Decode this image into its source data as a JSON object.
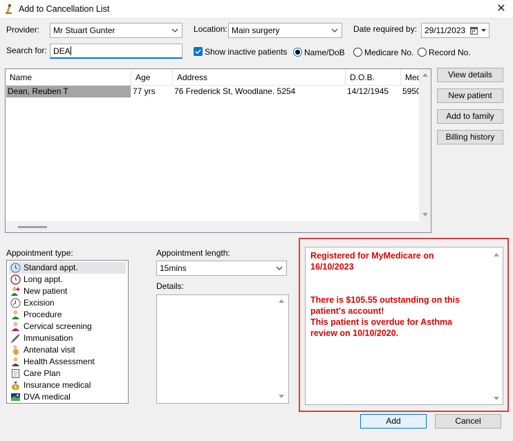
{
  "window": {
    "title": "Add to Cancellation List",
    "close_glyph": "✕"
  },
  "provider": {
    "label": "Provider:",
    "value": "Mr Stuart Gunter"
  },
  "location": {
    "label": "Location:",
    "value": "Main surgery"
  },
  "date_required": {
    "label": "Date required by:",
    "value": "29/11/2023"
  },
  "search": {
    "label": "Search for:",
    "value": "DEA"
  },
  "show_inactive": {
    "label": "Show inactive patients",
    "checked": true
  },
  "search_mode": {
    "options": [
      "Name/DoB",
      "Medicare No.",
      "Record No."
    ],
    "selected": "Name/DoB"
  },
  "patient_table": {
    "columns": [
      "Name",
      "Age",
      "Address",
      "D.O.B.",
      "Med"
    ],
    "rows": [
      {
        "name": "Dean, Reuben T",
        "age": "77 yrs",
        "address": "76 Frederick St, Woodlane. 5254",
        "dob": "14/12/1945",
        "medicare": "5950"
      }
    ]
  },
  "side_buttons": [
    "View details",
    "New patient",
    "Add to family",
    "Billing history"
  ],
  "appointment_type": {
    "label": "Appointment type:",
    "items": [
      {
        "label": "Standard appt.",
        "icon": "clock-icon",
        "selected": true
      },
      {
        "label": "Long appt.",
        "icon": "long-clock-icon"
      },
      {
        "label": "New patient",
        "icon": "person-plus-icon"
      },
      {
        "label": "Excision",
        "icon": "excision-clock-icon"
      },
      {
        "label": "Procedure",
        "icon": "person-icon"
      },
      {
        "label": "Cervical screening",
        "icon": "person-female-icon"
      },
      {
        "label": "Immunisation",
        "icon": "syringe-icon"
      },
      {
        "label": "Antenatal visit",
        "icon": "pregnant-icon"
      },
      {
        "label": "Health Assessment",
        "icon": "health-person-icon"
      },
      {
        "label": "Care Plan",
        "icon": "document-icon"
      },
      {
        "label": "Insurance medical",
        "icon": "money-bag-icon"
      },
      {
        "label": "DVA medical",
        "icon": "flag-icon"
      }
    ]
  },
  "appointment_length": {
    "label": "Appointment length:",
    "value": "15mins"
  },
  "details": {
    "label": "Details:"
  },
  "notes": {
    "lines": [
      "Registered for MyMedicare on",
      "16/10/2023",
      "",
      "There is $105.55 outstanding on this",
      "patient's account!",
      "This patient is overdue for Asthma",
      "review on 10/10/2020."
    ],
    "color": "#e00000",
    "highlight_border": "#e03c3c"
  },
  "footer": {
    "add_label": "Add",
    "cancel_label": "Cancel"
  },
  "colors": {
    "accent": "#0078d7",
    "window_bg": "#f0f0f0"
  }
}
